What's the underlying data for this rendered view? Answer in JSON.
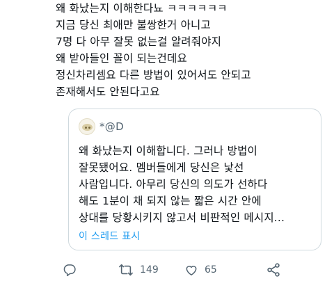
{
  "tweet": {
    "lines": [
      "왜 화났는지 이해한다뇨 ㅋㅋㅋㅋㅋㅋ",
      "지금 당신 최애만 불쌍한거 아니고",
      "7명 다 아무 잘못 없는걸 알려줘야지",
      "왜 받아들인 꼴이 되는건데요",
      "정신차리셈요 다른 방법이 있어서도 안되고",
      "존재해서도 안된다고요"
    ]
  },
  "quote": {
    "handle": "*@D",
    "lines": [
      "왜 화났는지 이해합니다. 그러나 방법이",
      "잘못됐어요. 멤버들에게 당신은 낯선",
      "사람입니다. 아무리 당신의 의도가 선하다",
      "해도 1분이 채 되지 않는 짧은 시간 안에",
      "상대를 당황시키지 않고서 비판적인 메시지..."
    ],
    "thread_link": "이 스레드 표시"
  },
  "actions": {
    "reply": {
      "icon": "reply-icon",
      "count": ""
    },
    "retweet": {
      "icon": "retweet-icon",
      "count": "149"
    },
    "like": {
      "icon": "heart-icon",
      "count": "65"
    },
    "share": {
      "icon": "share-icon",
      "count": ""
    }
  },
  "colors": {
    "text": "#0f1419",
    "muted": "#536471",
    "link": "#1d9bf0",
    "border": "#cfd9de"
  }
}
